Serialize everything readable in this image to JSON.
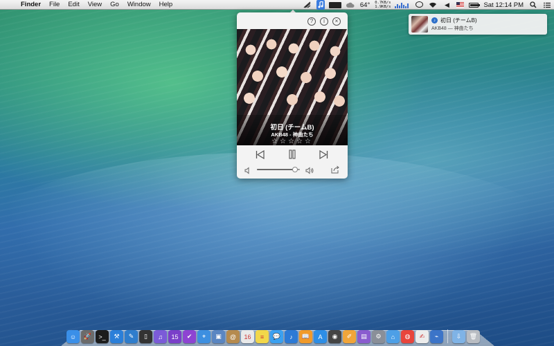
{
  "menubar": {
    "apple_glyph": "",
    "app_name": "Finder",
    "menus": [
      "File",
      "Edit",
      "View",
      "Go",
      "Window",
      "Help"
    ],
    "status": {
      "temperature": "64°",
      "net_up": "0.7KB/s",
      "net_down": "1.9KB/s",
      "battery_level": 0.85,
      "clock": "Sat 12:14 PM"
    }
  },
  "notification": {
    "title": "初日 (チームB)",
    "subtitle": "AKB48 — 神曲たち",
    "app_icon": "music-note-icon"
  },
  "player": {
    "help_glyph": "?",
    "info_glyph": "i",
    "close_glyph": "×",
    "track_title": "初日 (チームB)",
    "track_artist": "AKB48 - 神曲たち",
    "rating_stars": "☆☆☆☆☆",
    "volume_level": 0.88
  },
  "dock": {
    "icons": [
      {
        "name": "finder-icon",
        "color": "#3a8fe8",
        "glyph": "☺"
      },
      {
        "name": "launchpad-icon",
        "color": "#6b6b6b",
        "glyph": "🚀"
      },
      {
        "name": "terminal-icon",
        "color": "#1c1c1c",
        "glyph": ">_"
      },
      {
        "name": "xcode-icon",
        "color": "#2b7fd9",
        "glyph": "⚒"
      },
      {
        "name": "notes-blue-icon",
        "color": "#2f7dcc",
        "glyph": "✎"
      },
      {
        "name": "iphone-icon",
        "color": "#333333",
        "glyph": "▯"
      },
      {
        "name": "itunes-bar-icon",
        "color": "#7b5bd8",
        "glyph": "♫"
      },
      {
        "name": "calendar-15-icon",
        "color": "#7a3fc9",
        "glyph": "15"
      },
      {
        "name": "omnifocus-icon",
        "color": "#8e44d2",
        "glyph": "✔"
      },
      {
        "name": "safari-icon",
        "color": "#3d8fe0",
        "glyph": "⌖"
      },
      {
        "name": "preview-icon",
        "color": "#5a86c2",
        "glyph": "▣"
      },
      {
        "name": "contacts-icon",
        "color": "#b58a4e",
        "glyph": "@"
      },
      {
        "name": "calendar-icon",
        "color": "#e9e9e9",
        "glyph": "16"
      },
      {
        "name": "stickies-icon",
        "color": "#f2d74a",
        "glyph": "≡"
      },
      {
        "name": "messages-icon",
        "color": "#3aa0f0",
        "glyph": "💬"
      },
      {
        "name": "itunes-icon",
        "color": "#2c7ad6",
        "glyph": "♪"
      },
      {
        "name": "ibooks-icon",
        "color": "#f09a2a",
        "glyph": "📖"
      },
      {
        "name": "app-store-icon",
        "color": "#2d8ee6",
        "glyph": "A"
      },
      {
        "name": "photo-booth-icon",
        "color": "#444444",
        "glyph": "◉"
      },
      {
        "name": "pages-icon",
        "color": "#f0a53a",
        "glyph": "✐"
      },
      {
        "name": "activity-icon",
        "color": "#8a5ccf",
        "glyph": "▤"
      },
      {
        "name": "system-preferences-icon",
        "color": "#8a8f98",
        "glyph": "⚙"
      },
      {
        "name": "maps-icon",
        "color": "#4d9fe6",
        "glyph": "⌂"
      },
      {
        "name": "chrome-icon",
        "color": "#e8453c",
        "glyph": "◍"
      },
      {
        "name": "textedit-icon",
        "color": "#ececec",
        "glyph": "✍"
      },
      {
        "name": "network-icon",
        "color": "#3c74c8",
        "glyph": "⌁"
      },
      {
        "name": "downloads-folder-icon",
        "color": "#7fb3e6",
        "glyph": "⇩"
      },
      {
        "name": "trash-icon",
        "color": "#b8bcc2",
        "glyph": "🗑"
      }
    ]
  }
}
